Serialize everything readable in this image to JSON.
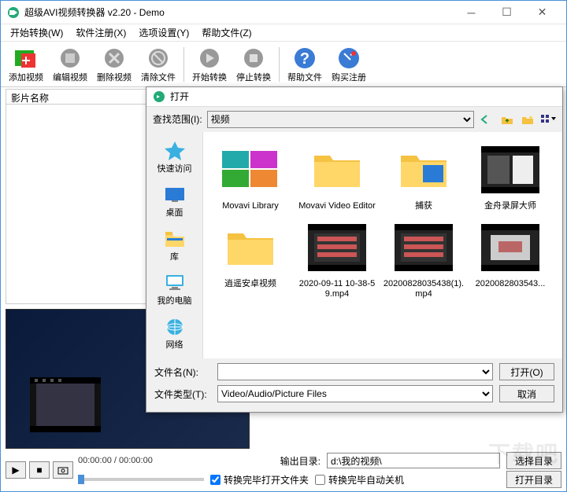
{
  "window": {
    "title": "超级AVI视频转换器 v2.20 - Demo"
  },
  "menu": {
    "start": "开始转换(W)",
    "register": "软件注册(X)",
    "options": "选项设置(Y)",
    "help": "帮助文件(Z)"
  },
  "toolbar": {
    "add": "添加视频",
    "edit": "编辑视频",
    "delete": "删除视频",
    "clear": "清除文件",
    "start": "开始转换",
    "stop": "停止转换",
    "help": "帮助文件",
    "buy": "购买注册"
  },
  "list": {
    "col_name": "影片名称"
  },
  "output": {
    "label": "输出目录:",
    "path": "d:\\我的视频\\",
    "browse": "选择目录",
    "open_dir": "打开目录",
    "open_on_done": "转换完毕打开文件夹",
    "shutdown_on_done": "转换完毕自动关机",
    "time": "00:00:00 / 00:00:00"
  },
  "open_dialog": {
    "title": "打开",
    "look_in_label": "查找范围(I):",
    "look_in_value": "视频",
    "places": {
      "quick": "快速访问",
      "desktop": "桌面",
      "libraries": "库",
      "computer": "我的电脑",
      "network": "网络"
    },
    "files": [
      {
        "name": "Movavi Library",
        "type": "folder-multi"
      },
      {
        "name": "Movavi Video Editor",
        "type": "folder"
      },
      {
        "name": "捕获",
        "type": "folder-blue"
      },
      {
        "name": "金舟录屏大师",
        "type": "video-thumb1"
      },
      {
        "name": "逍遥安卓视频",
        "type": "folder"
      },
      {
        "name": "2020-09-11 10-38-59.mp4",
        "type": "video-thumb2"
      },
      {
        "name": "20200828035438(1).mp4",
        "type": "video-thumb2"
      },
      {
        "name": "2020082803543...",
        "type": "video-thumb3"
      }
    ],
    "filename_label": "文件名(N):",
    "filename_value": "",
    "filetype_label": "文件类型(T):",
    "filetype_value": "Video/Audio/Picture Files",
    "open_btn": "打开(O)",
    "cancel_btn": "取消"
  },
  "watermark": "下载吧"
}
